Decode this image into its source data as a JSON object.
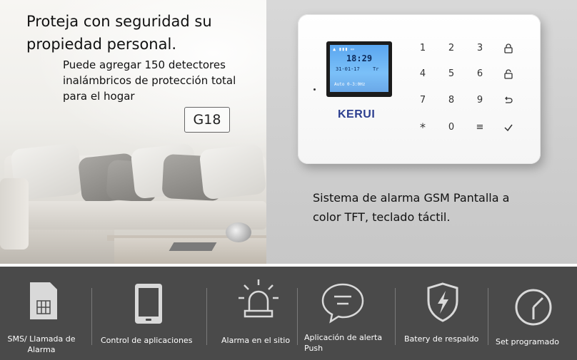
{
  "banner": {
    "headline_line1": "Proteja con seguridad su",
    "headline_line2": "propiedad personal.",
    "subtext_line1": "Puede agregar 150 detectores",
    "subtext_line2": "inalámbricos de protección total",
    "subtext_line3": "para el hogar",
    "model": "G18",
    "caption_line1": "Sistema de alarma GSM Pantalla a",
    "caption_line2": "color TFT, teclado táctil."
  },
  "device": {
    "brand": "KERUI",
    "screen_time": "18:29",
    "screen_date": "31-01-17",
    "screen_day": "Tr",
    "screen_footer": "Auto 0-3:0Hz",
    "keys": [
      "1",
      "2",
      "3",
      "lock-closed-icon",
      "4",
      "5",
      "6",
      "lock-open-icon",
      "7",
      "8",
      "9",
      "back-arrow-icon",
      "*",
      "0",
      "≡",
      "check-icon"
    ]
  },
  "features": [
    {
      "icon": "sim-card-icon",
      "label_line1": "SMS/ Llamada de",
      "label_line2": "Alarma"
    },
    {
      "icon": "tablet-icon",
      "label_line1": "Control de aplicaciones",
      "label_line2": ""
    },
    {
      "icon": "siren-icon",
      "label_line1": "Alarma en el sitio",
      "label_line2": ""
    },
    {
      "icon": "chat-bubble-icon",
      "label_line1": "Aplicación de alerta",
      "label_line2": "Push"
    },
    {
      "icon": "shield-bolt-icon",
      "label_line1": "Batery de respaldo",
      "label_line2": ""
    },
    {
      "icon": "clock-icon",
      "label_line1": "Set programado",
      "label_line2": ""
    }
  ],
  "colors": {
    "feature_bar_bg": "#4a4a4a",
    "icon_color": "#d9d9d9",
    "brand_blue": "#2c3e8f"
  }
}
